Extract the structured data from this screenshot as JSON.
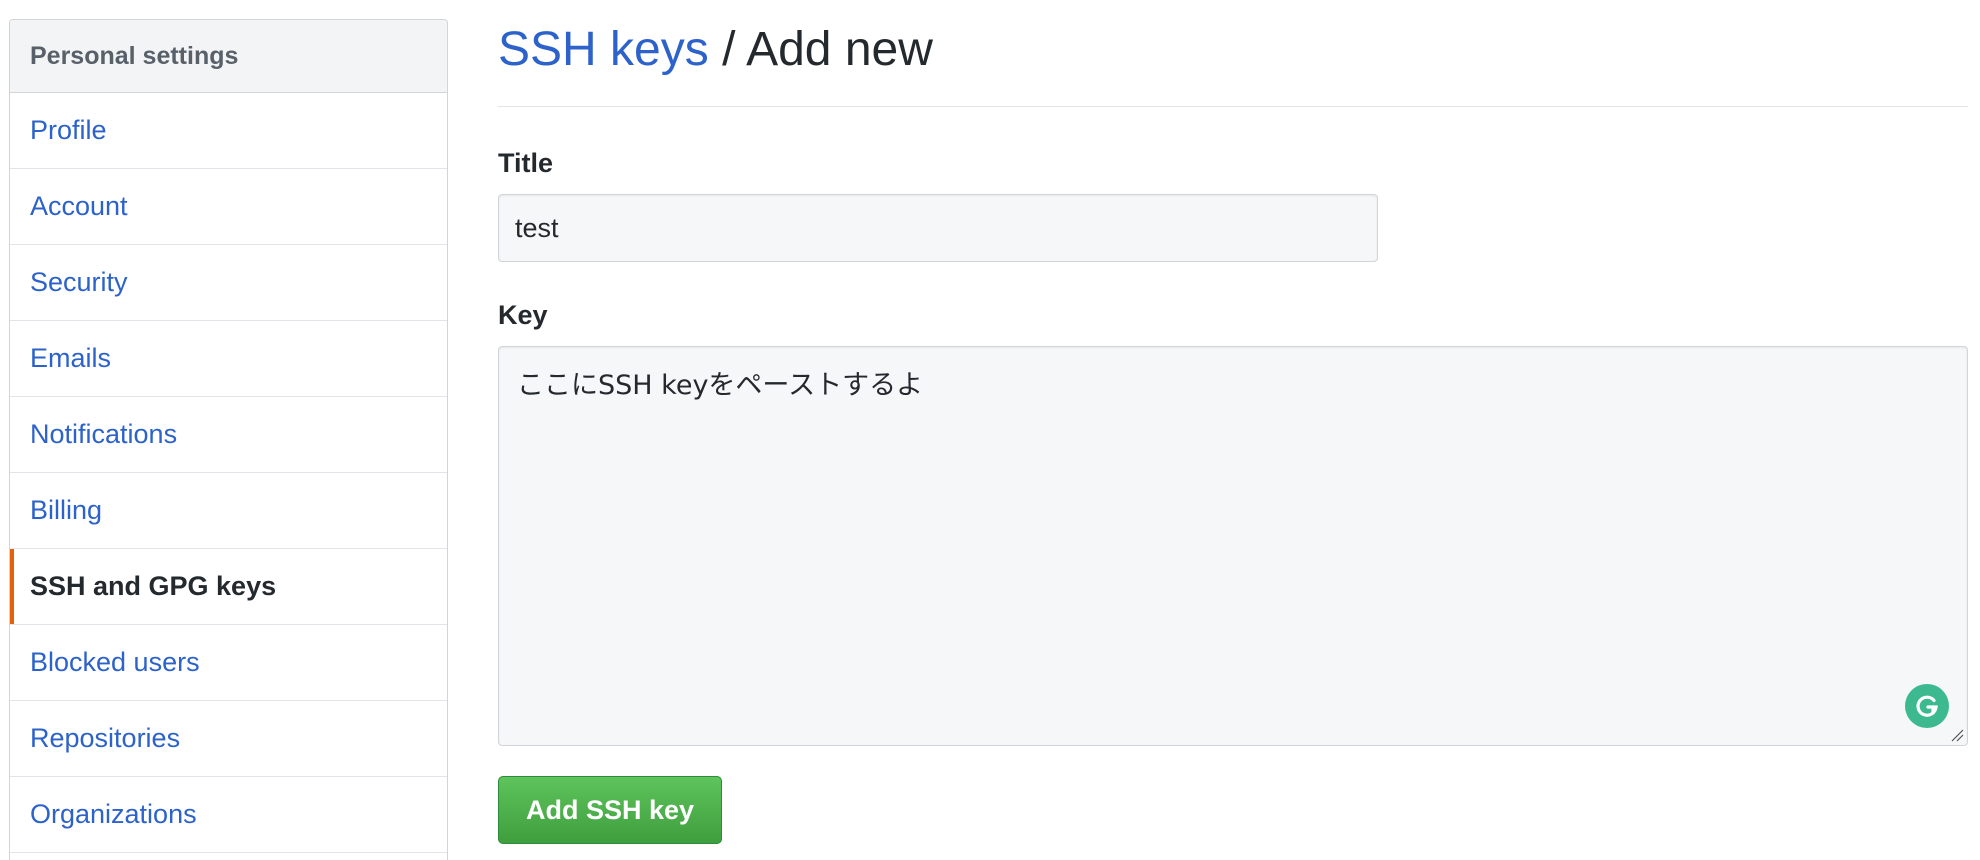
{
  "sidebar": {
    "header": "Personal settings",
    "items": [
      {
        "label": "Profile",
        "active": false
      },
      {
        "label": "Account",
        "active": false
      },
      {
        "label": "Security",
        "active": false
      },
      {
        "label": "Emails",
        "active": false
      },
      {
        "label": "Notifications",
        "active": false
      },
      {
        "label": "Billing",
        "active": false
      },
      {
        "label": "SSH and GPG keys",
        "active": true
      },
      {
        "label": "Blocked users",
        "active": false
      },
      {
        "label": "Repositories",
        "active": false
      },
      {
        "label": "Organizations",
        "active": false
      }
    ]
  },
  "header": {
    "crumb_link": "SSH keys",
    "separator": " / ",
    "current": "Add new"
  },
  "form": {
    "title_label": "Title",
    "title_value": "test",
    "key_label": "Key",
    "key_value": "ここにSSH keyをペーストするよ",
    "submit_label": "Add SSH key"
  },
  "icons": {
    "grammarly": "grammarly-icon",
    "resize": "resize-handle-icon"
  },
  "colors": {
    "link": "#2c62c9",
    "active_marker": "#e36209",
    "button_green": "#4cae4a",
    "grammarly": "#3db990"
  }
}
